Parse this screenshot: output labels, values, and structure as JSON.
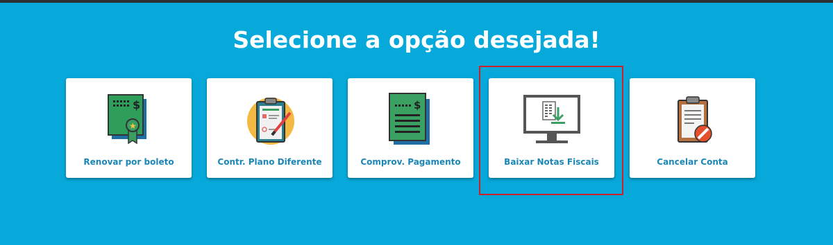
{
  "page": {
    "title": "Selecione a opção desejada!"
  },
  "options": [
    {
      "label": "Renovar por boleto",
      "icon": "certificate-payment-icon"
    },
    {
      "label": "Contr. Plano Diferente",
      "icon": "clipboard-contract-icon"
    },
    {
      "label": "Comprov. Pagamento",
      "icon": "payment-receipt-icon"
    },
    {
      "label": "Baixar Notas Fiscais",
      "icon": "monitor-download-icon"
    },
    {
      "label": "Cancelar Conta",
      "icon": "clipboard-cancel-icon"
    }
  ],
  "highlight": {
    "target": "Baixar Notas Fiscais",
    "color": "#d0202a"
  },
  "colors": {
    "background": "#07a9da",
    "label": "#1a87b8",
    "card": "#ffffff"
  }
}
